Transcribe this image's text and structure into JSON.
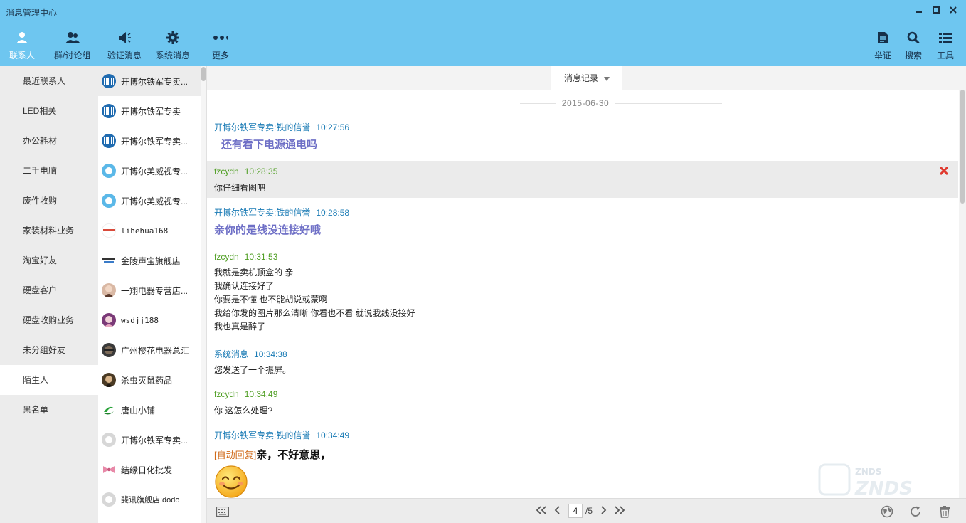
{
  "window": {
    "title": "消息管理中心"
  },
  "toolbar": {
    "contacts": "联系人",
    "groups": "群/讨论组",
    "verify": "验证消息",
    "system": "系统消息",
    "more": "更多",
    "report": "举证",
    "search": "搜索",
    "tools": "工具"
  },
  "groups": [
    {
      "label": "最近联系人"
    },
    {
      "label": "LED相关"
    },
    {
      "label": "办公耗材"
    },
    {
      "label": "二手电脑"
    },
    {
      "label": "废件收购"
    },
    {
      "label": "家装材料业务"
    },
    {
      "label": "淘宝好友"
    },
    {
      "label": "硬盘客户"
    },
    {
      "label": "硬盘收购业务"
    },
    {
      "label": "未分组好友"
    },
    {
      "label": "陌生人"
    },
    {
      "label": "黑名单"
    }
  ],
  "contacts": [
    {
      "name": "开博尔铁军专卖...",
      "icon": "barcode-logo"
    },
    {
      "name": "开博尔铁军专卖",
      "icon": "barcode-logo"
    },
    {
      "name": "开博尔铁军专卖...",
      "icon": "barcode-logo"
    },
    {
      "name": "开博尔美威视专...",
      "icon": "circle-logo"
    },
    {
      "name": "开博尔美威视专...",
      "icon": "circle-logo"
    },
    {
      "name": "lihehua168",
      "icon": "text-logo"
    },
    {
      "name": "金陵声宝旗舰店",
      "icon": "brand-logo"
    },
    {
      "name": "一翔电器专营店...",
      "icon": "person-photo"
    },
    {
      "name": "wsdjj188",
      "icon": "person-photo"
    },
    {
      "name": "广州樱花电器总汇",
      "icon": "person-photo"
    },
    {
      "name": "杀虫灭鼠药品",
      "icon": "person-photo"
    },
    {
      "name": "唐山小铺",
      "icon": "green-logo"
    },
    {
      "name": "开博尔铁军专卖...",
      "icon": "default-avatar"
    },
    {
      "name": "结缘日化批发",
      "icon": "bow-logo"
    },
    {
      "name": "斐讯旗舰店:dodo",
      "icon": "default-avatar"
    }
  ],
  "chat": {
    "history_label": "消息记录",
    "date": "2015-06-30",
    "messages": [
      {
        "sender": "开博尔铁军专卖:铁的信誉",
        "time": "10:27:56",
        "lines": [
          "还有看下电源通电吗"
        ]
      },
      {
        "sender": "fzcydn",
        "time": "10:28:35",
        "lines": [
          "你仔细看图吧"
        ]
      },
      {
        "sender": "开博尔铁军专卖:铁的信誉",
        "time": "10:28:58",
        "lines": [
          "亲你的是线没连接好哦"
        ]
      },
      {
        "sender": "fzcydn",
        "time": "10:31:53",
        "lines": [
          "我就是卖机顶盒的  亲",
          "我确认连接好了",
          "你要是不懂  也不能胡说或蒙啊",
          "我给你发的图片那么清晰  你看也不看  就说我线没接好",
          "我也真是醉了"
        ]
      },
      {
        "sender": "系统消息",
        "time": "10:34:38",
        "lines": [
          "您发送了一个振屏。"
        ]
      },
      {
        "sender": "fzcydn",
        "time": "10:34:49",
        "lines": [
          "你  这怎么处理?"
        ]
      },
      {
        "sender": "开博尔铁军专卖:铁的信誉",
        "time": "10:34:49",
        "auto_tag": "[自动回复]",
        "lines": [
          "亲，不好意思，"
        ]
      }
    ]
  },
  "pager": {
    "current": "4",
    "total": "/5"
  },
  "colors": {
    "toolbar": "#6ec6f0",
    "sender_blue": "#1a7bb5",
    "sender_green": "#4f9e23",
    "accent_text": "#6e6fc6",
    "delete": "#e03a2f"
  }
}
